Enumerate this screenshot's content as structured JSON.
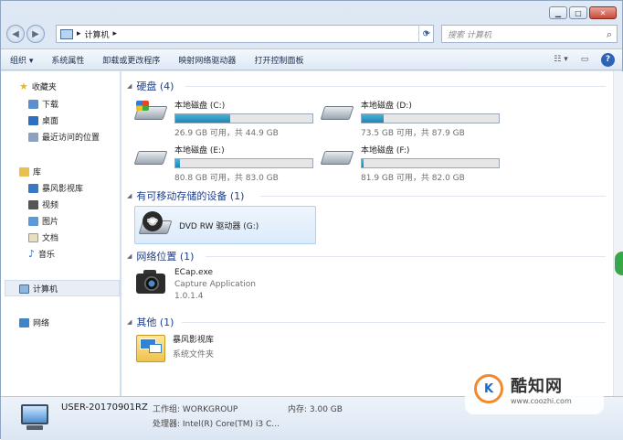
{
  "address": {
    "path": "计算机",
    "separator": "▸"
  },
  "search": {
    "placeholder": "搜索 计算机"
  },
  "toolbar": {
    "organize": "组织 ▾",
    "system_properties": "系统属性",
    "uninstall": "卸载或更改程序",
    "map_drive": "映射网络驱动器",
    "control_panel": "打开控制面板"
  },
  "nav": {
    "favorites": "收藏夹",
    "downloads": "下载",
    "desktop": "桌面",
    "recent": "最近访问的位置",
    "libraries": "库",
    "storm_lib": "暴风影视库",
    "videos": "视频",
    "pictures": "图片",
    "documents": "文档",
    "music": "音乐",
    "computer": "计算机",
    "network": "网络"
  },
  "groups": {
    "hdd": "硬盘 (4)",
    "removable": "有可移动存储的设备 (1)",
    "netloc": "网络位置 (1)",
    "other": "其他 (1)"
  },
  "drives": [
    {
      "name": "本地磁盘 (C:)",
      "info": "26.9 GB 可用，共 44.9 GB",
      "used_pct": 40
    },
    {
      "name": "本地磁盘 (D:)",
      "info": "73.5 GB 可用，共 87.9 GB",
      "used_pct": 16
    },
    {
      "name": "本地磁盘 (E:)",
      "info": "80.8 GB 可用，共 83.0 GB",
      "used_pct": 3
    },
    {
      "name": "本地磁盘 (F:)",
      "info": "81.9 GB 可用，共 82.0 GB",
      "used_pct": 1
    }
  ],
  "dvd": {
    "name": "DVD RW 驱动器 (G:)",
    "disc_label": "DVD"
  },
  "ecap": {
    "name": "ECap.exe",
    "desc": "Capture Application",
    "version": "1.0.1.4"
  },
  "storm": {
    "name": "暴风影视库",
    "type": "系统文件夹"
  },
  "details": {
    "computer_name": "USER-20170901RZ",
    "workgroup": "工作组: WORKGROUP",
    "memory": "内存: 3.00 GB",
    "cpu": "处理器: Intel(R) Core(TM) i3 C..."
  },
  "watermark": {
    "brand": "酷知网",
    "url": "www.coozhi.com"
  },
  "colors": {
    "group_header": "#1e3f87",
    "bar_fill": "#1e86b5",
    "accent": "#2f64b5"
  }
}
